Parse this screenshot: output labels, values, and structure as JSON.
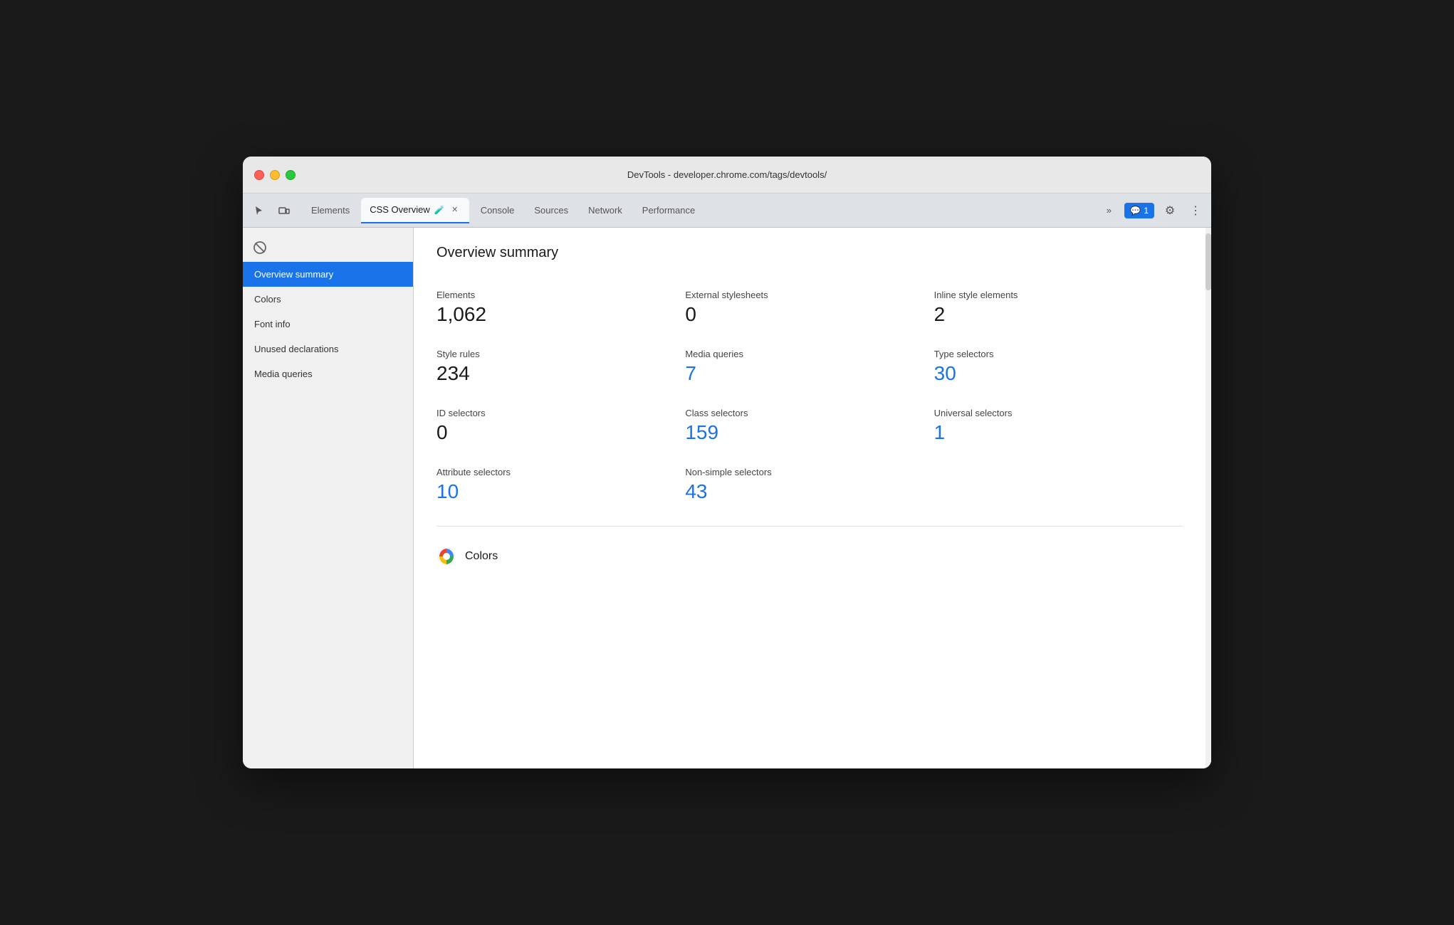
{
  "browser": {
    "title": "DevTools - developer.chrome.com/tags/devtools/",
    "traffic_lights": [
      "red",
      "yellow",
      "green"
    ]
  },
  "tabs": {
    "items": [
      {
        "id": "elements",
        "label": "Elements",
        "active": false,
        "closeable": false
      },
      {
        "id": "css-overview",
        "label": "CSS Overview",
        "active": true,
        "closeable": true,
        "has_icon": true
      },
      {
        "id": "console",
        "label": "Console",
        "active": false,
        "closeable": false
      },
      {
        "id": "sources",
        "label": "Sources",
        "active": false,
        "closeable": false
      },
      {
        "id": "network",
        "label": "Network",
        "active": false,
        "closeable": false
      },
      {
        "id": "performance",
        "label": "Performance",
        "active": false,
        "closeable": false
      }
    ],
    "more_label": "»",
    "notification_count": "1",
    "settings_label": "⚙",
    "more_options_label": "⋮"
  },
  "sidebar": {
    "items": [
      {
        "id": "overview-summary",
        "label": "Overview summary",
        "active": true
      },
      {
        "id": "colors",
        "label": "Colors",
        "active": false
      },
      {
        "id": "font-info",
        "label": "Font info",
        "active": false
      },
      {
        "id": "unused-declarations",
        "label": "Unused declarations",
        "active": false
      },
      {
        "id": "media-queries",
        "label": "Media queries",
        "active": false
      }
    ]
  },
  "main": {
    "section_title": "Overview summary",
    "stats": [
      {
        "id": "elements",
        "label": "Elements",
        "value": "1,062",
        "clickable": false
      },
      {
        "id": "external-stylesheets",
        "label": "External stylesheets",
        "value": "0",
        "clickable": false
      },
      {
        "id": "inline-style-elements",
        "label": "Inline style elements",
        "value": "2",
        "clickable": false
      },
      {
        "id": "style-rules",
        "label": "Style rules",
        "value": "234",
        "clickable": false
      },
      {
        "id": "media-queries",
        "label": "Media queries",
        "value": "7",
        "clickable": true
      },
      {
        "id": "type-selectors",
        "label": "Type selectors",
        "value": "30",
        "clickable": true
      },
      {
        "id": "id-selectors",
        "label": "ID selectors",
        "value": "0",
        "clickable": false
      },
      {
        "id": "class-selectors",
        "label": "Class selectors",
        "value": "159",
        "clickable": true
      },
      {
        "id": "universal-selectors",
        "label": "Universal selectors",
        "value": "1",
        "clickable": true
      },
      {
        "id": "attribute-selectors",
        "label": "Attribute selectors",
        "value": "10",
        "clickable": true
      },
      {
        "id": "non-simple-selectors",
        "label": "Non-simple selectors",
        "value": "43",
        "clickable": true
      }
    ],
    "colors_section_title": "Colors"
  }
}
